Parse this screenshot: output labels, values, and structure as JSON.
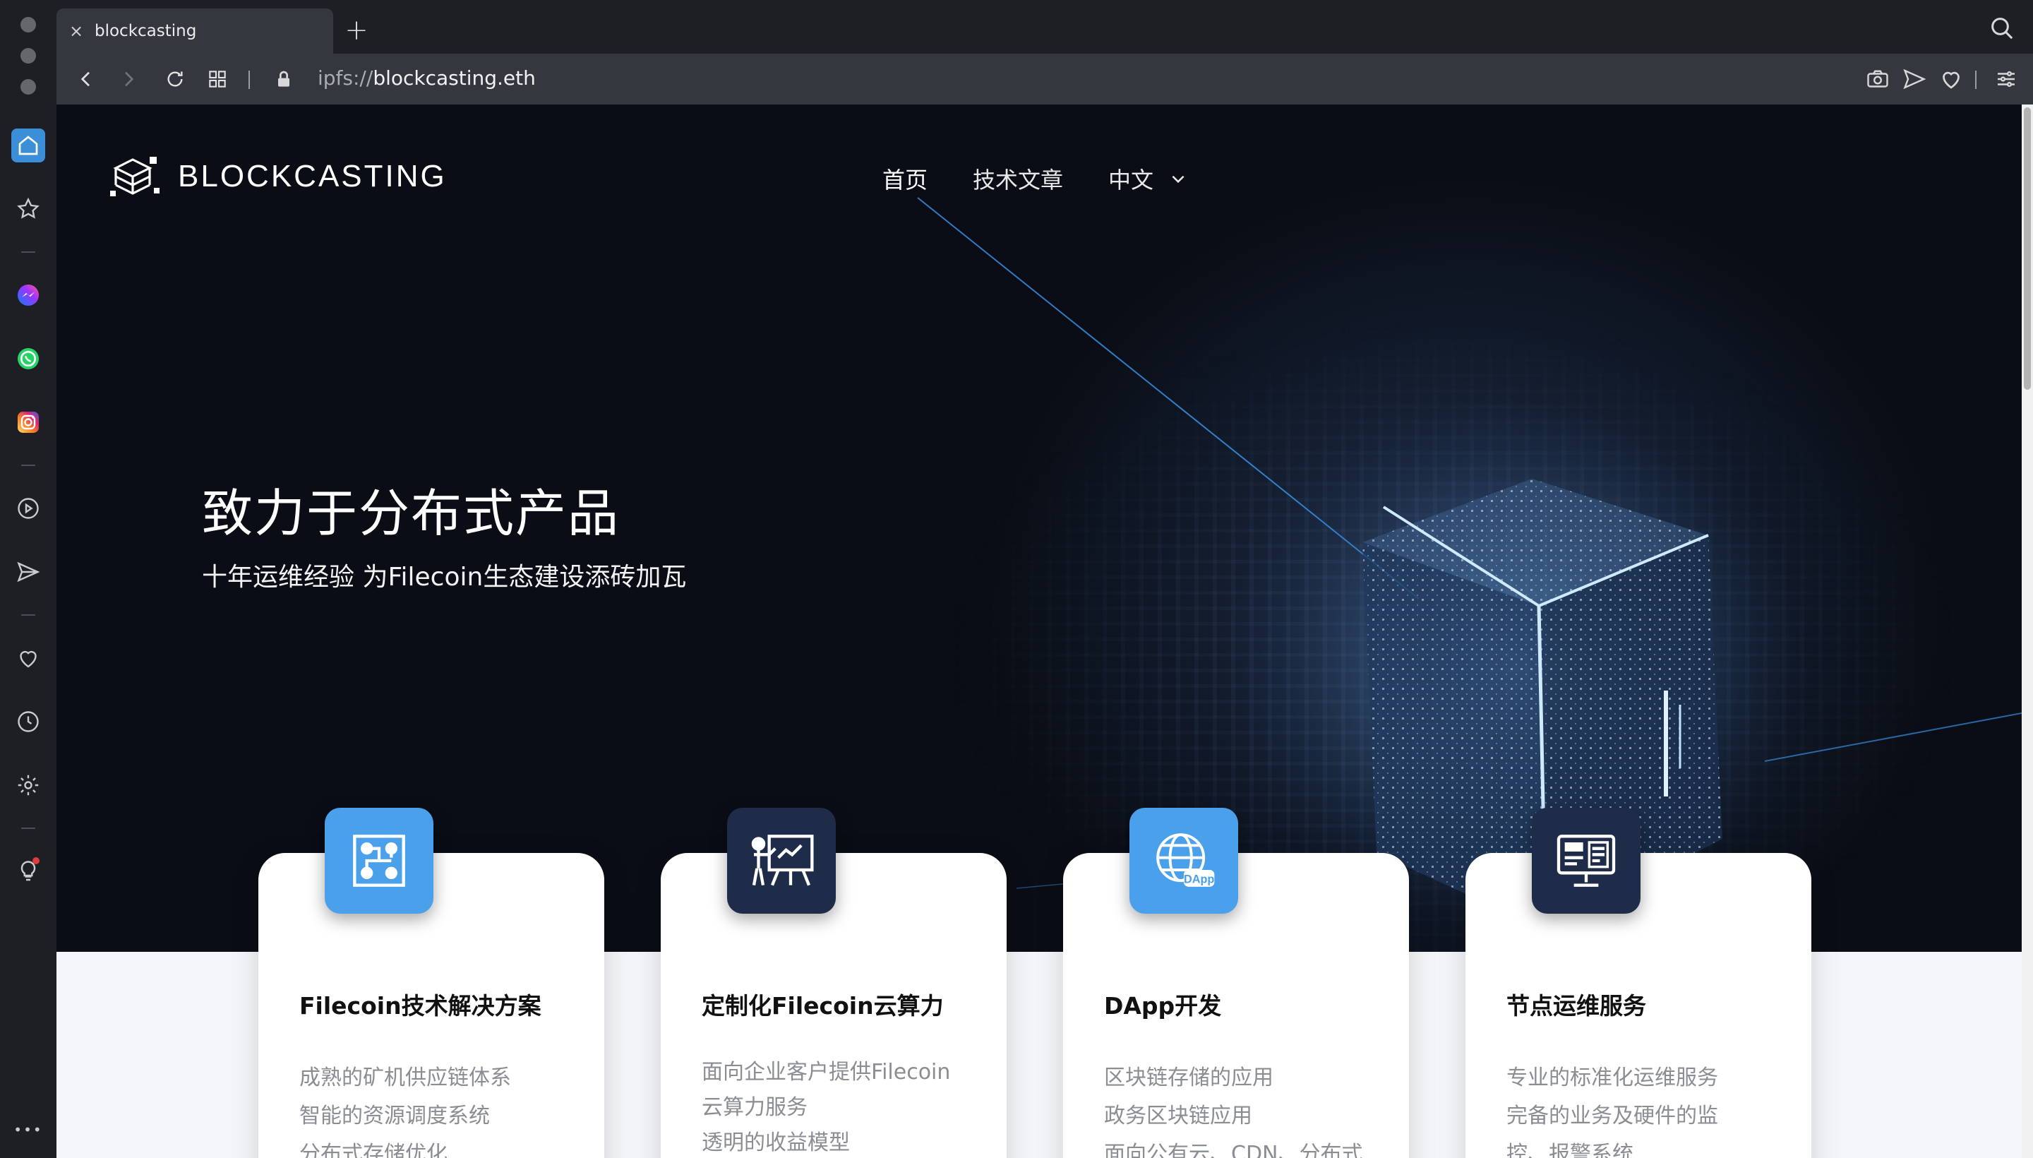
{
  "browser": {
    "tab": {
      "title": "blockcasting",
      "close_glyph": "×"
    },
    "new_tab_glyph": "+",
    "address": {
      "scheme": "ipfs://",
      "host": "blockcasting.eth"
    },
    "toolbar_icons": [
      "back-icon",
      "forward-icon",
      "reload-icon",
      "tabs-grid-icon",
      "lock-icon",
      "camera-icon",
      "send-icon",
      "heart-icon",
      "menu-icon"
    ],
    "sidebar_icons": [
      "home-icon",
      "star-icon",
      "messenger-icon",
      "whatsapp-icon",
      "instagram-icon",
      "play-icon",
      "send-icon",
      "heart-icon",
      "history-icon",
      "settings-icon",
      "bulb-icon",
      "more-icon"
    ],
    "more_glyph": "•••"
  },
  "site": {
    "brand": "BLOCKCASTING",
    "nav": [
      {
        "label": "首页",
        "active": true
      },
      {
        "label": "技术文章",
        "active": false
      }
    ],
    "lang_label": "中文",
    "hero": {
      "title": "致力于分布式产品",
      "subtitle": "十年运维经验 为Filecoin生态建设添砖加瓦"
    },
    "cards": [
      {
        "title": "Filecoin技术解决方案",
        "icon": "circuit-icon",
        "icon_style": "light",
        "lines": [
          "成熟的矿机供应链体系",
          "智能的资源调度系统",
          "分布式存储优化"
        ]
      },
      {
        "title": "定制化Filecoin云算力",
        "icon": "presentation-icon",
        "icon_style": "dark",
        "lines": [
          "面向企业客户提供Filecoin",
          "云算力服务",
          "透明的收益模型"
        ]
      },
      {
        "title": "DApp开发",
        "icon": "dapp-globe-icon",
        "icon_style": "light",
        "lines": [
          "区块链存储的应用",
          "政务区块链应用",
          "面向公有云、CDN、分布式"
        ]
      },
      {
        "title": "节点运维服务",
        "icon": "monitor-dashboard-icon",
        "icon_style": "dark",
        "lines": [
          "专业的标准化运维服务",
          "完备的业务及硬件的监",
          "控、报警系统"
        ]
      }
    ]
  },
  "colors": {
    "accent_blue": "#4aa0ea",
    "dark_navy": "#1e2c4a",
    "hero_bg": "#07090f"
  }
}
